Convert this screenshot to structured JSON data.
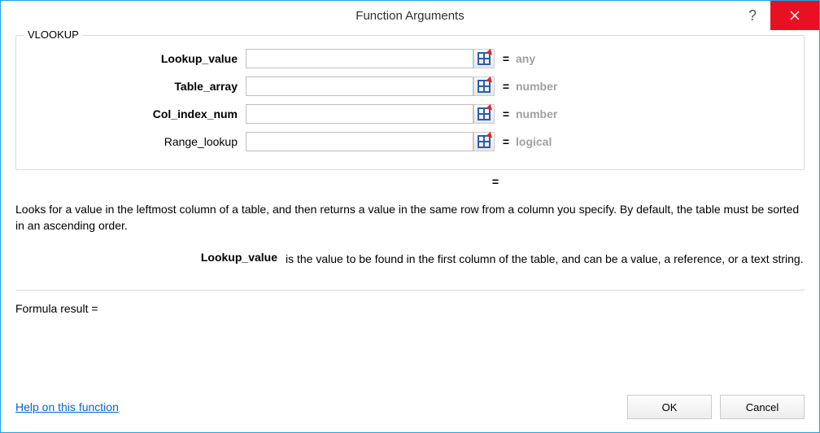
{
  "window": {
    "title": "Function Arguments"
  },
  "function_name": "VLOOKUP",
  "args": [
    {
      "label": "Lookup_value",
      "bold": true,
      "value": "",
      "hint": "any"
    },
    {
      "label": "Table_array",
      "bold": true,
      "value": "",
      "hint": "number"
    },
    {
      "label": "Col_index_num",
      "bold": true,
      "value": "",
      "hint": "number"
    },
    {
      "label": "Range_lookup",
      "bold": false,
      "value": "",
      "hint": "logical"
    }
  ],
  "eq_symbol": "=",
  "result_preview": "",
  "description": "Looks for a value in the leftmost column of a table, and then returns a value in the same row from a column you specify. By default, the table must be sorted in an ascending order.",
  "current_arg": {
    "label": "Lookup_value",
    "text": "is the value to be found in the first column of the table, and can be a value, a reference, or a text string."
  },
  "formula_result_label": "Formula result =",
  "formula_result_value": "",
  "help_link": "Help on this function",
  "buttons": {
    "ok": "OK",
    "cancel": "Cancel"
  }
}
